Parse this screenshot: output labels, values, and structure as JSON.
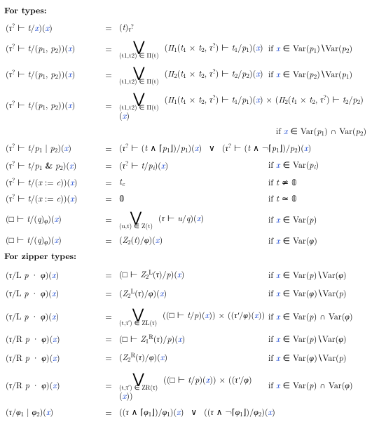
{
  "headings": {
    "types": "For types:",
    "zippers": "For zipper types:"
  },
  "types_rules": [
    {
      "lhs": "(τ? ⊢ t/x)(x)",
      "eq": "=",
      "rhs_plain": "(t)τ?",
      "cond": ""
    },
    {
      "lhs": "(τ? ⊢ t/(p1, p2))(x)",
      "eq": "=",
      "bigop_sub": "(t1,t2) ∈ Π(t)",
      "rhs_after": "(Π1(t1 × t2, τ?) ⊢ t1/p1)(x)",
      "cond": "if x ∈ Var(p1)∖Var(p2)"
    },
    {
      "lhs": "(τ? ⊢ t/(p1, p2))(x)",
      "eq": "=",
      "bigop_sub": "(t1,t2) ∈ Π(t)",
      "rhs_after": "(Π2(t1 × t2, τ?) ⊢ t2/p2)(x)",
      "cond": "if x ∈ Var(p2)∖Var(p1)"
    },
    {
      "lhs": "(τ? ⊢ t/(p1, p2))(x)",
      "eq": "=",
      "bigop_sub": "(t1,t2) ∈ Π(t)",
      "rhs_after": "(Π1(t1 × t2, τ?) ⊢ t1/p1)(x) × (Π2(t1 × t2, τ?) ⊢ t2/p2)(x)",
      "cond": ""
    },
    {
      "cond_only": "if x ∈ Var(p1) ∩ Var(p2)"
    },
    {
      "lhs": "(τ? ⊢ t/p1 | p2)(x)",
      "eq": "=",
      "rhs_plain": "(τ? ⊢ (t ∧ ⌈p1⌋)/p1)(x)  ∨  (τ? ⊢ (t ∧ ¬⌈p1⌋)/p2)(x)",
      "cond": ""
    },
    {
      "lhs": "(τ? ⊢ t/p1 & p2)(x)",
      "eq": "=",
      "rhs_plain": "(τ? ⊢ t/pi)(x)",
      "cond": "if x ∈ Var(pi)"
    },
    {
      "lhs": "(τ? ⊢ t/(x := c))(x)",
      "eq": "=",
      "rhs_plain": "tc",
      "cond": "if t ≄ 𝟘"
    },
    {
      "lhs": "(τ? ⊢ t/(x := c))(x)",
      "eq": "=",
      "rhs_plain": "𝟘",
      "cond": "if t ≃ 𝟘"
    },
    {
      "lhs": "(□ ⊢ t/(q)φ)(x)",
      "eq": "=",
      "bigop_sub": "(u,τ) ∈ Z(t)",
      "rhs_after": "(τ ⊢ u/q)(x)",
      "cond": "if x ∈ Var(p)"
    },
    {
      "lhs": "(□ ⊢ t/(q)φ)(x)",
      "eq": "=",
      "rhs_plain": "(Z2(t)/φ)(x)",
      "cond": "if x ∈ Var(φ)"
    }
  ],
  "zipper_rules": [
    {
      "lhs": "(τ/L p · φ)(x)",
      "eq": "=",
      "rhs_plain": "(□ ⊢ Z2L(τ)/p)(x)",
      "cond": "if x ∈ Var(p)∖Var(φ)"
    },
    {
      "lhs": "(τ/L p · φ)(x)",
      "eq": "=",
      "rhs_plain": "(Z2L(τ)/φ)(x)",
      "cond": "if x ∈ Var(φ)∖Var(p)"
    },
    {
      "lhs": "(τ/L p · φ)(x)",
      "eq": "=",
      "bigop_sub": "(t,τ′) ∈ ZL(τ)",
      "rhs_after": "((□ ⊢ t/p)(x)) × ((τ′/φ)(x))",
      "cond": "if x ∈ Var(p) ∩ Var(φ)"
    },
    {
      "lhs": "(τ/R p · φ)(x)",
      "eq": "=",
      "rhs_plain": "(□ ⊢ Z1R(τ)/p)(x)",
      "cond": "if x ∈ Var(p)∖Var(φ)"
    },
    {
      "lhs": "(τ/R p · φ)(x)",
      "eq": "=",
      "rhs_plain": "(Z2R(τ)/φ)(x)",
      "cond": "if x ∈ Var(φ)∖Var(p)"
    },
    {
      "lhs": "(τ/R p · φ)(x)",
      "eq": "=",
      "bigop_sub": "(t,τ′) ∈ ZR(τ)",
      "rhs_after": "((□ ⊢ t/p)(x)) × ((τ′/φ)(x))",
      "cond": "if x ∈ Var(p) ∩ Var(φ)"
    },
    {
      "lhs": "(τ/φ1 | φ2)(x)",
      "eq": "=",
      "rhs_plain": "((τ ∧ ⌈φ1⌋)/φ1)(x)  ∨  ((τ ∧ ¬⌈φ1⌋)/φ2)(x)",
      "cond": ""
    }
  ]
}
